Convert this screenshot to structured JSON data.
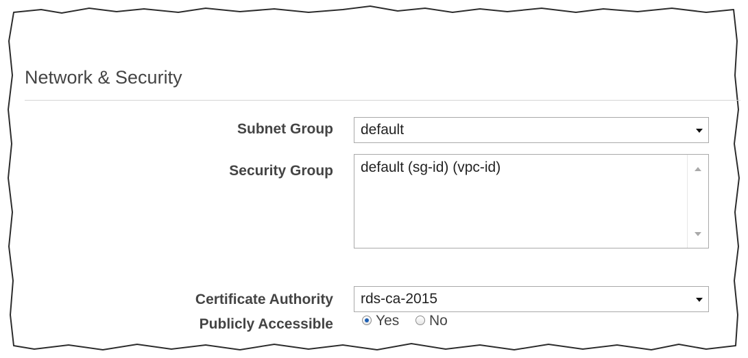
{
  "section": {
    "title": "Network & Security"
  },
  "fields": {
    "subnet_group": {
      "label": "Subnet Group",
      "value": "default"
    },
    "security_group": {
      "label": "Security Group",
      "options": [
        "default (sg-id) (vpc-id)"
      ]
    },
    "certificate_authority": {
      "label": "Certificate Authority",
      "value": "rds-ca-2015"
    },
    "publicly_accessible": {
      "label": "Publicly Accessible",
      "options": [
        {
          "label": "Yes",
          "selected": true
        },
        {
          "label": "No",
          "selected": false
        }
      ]
    }
  },
  "colors": {
    "radio_selected": "#1c5fb3",
    "border": "#a8a8a8",
    "divider": "#d4d4d4"
  }
}
